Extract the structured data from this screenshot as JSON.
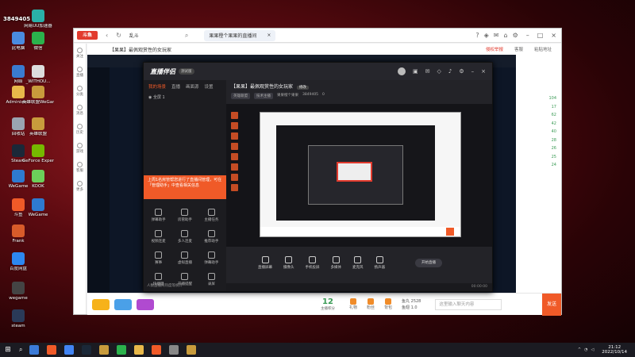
{
  "desktop": {
    "top_text": "3849405",
    "icons": [
      {
        "label": "此电脑",
        "color": "#4a8be0"
      },
      {
        "label": "网络",
        "color": "#3a7bd0"
      },
      {
        "label": "Administr...",
        "color": "#e8b84a"
      },
      {
        "label": "回收站",
        "color": "#9aa4b0"
      },
      {
        "label": "Steam",
        "color": "#1b2838"
      },
      {
        "label": "WeGame",
        "color": "#2e7ad0"
      },
      {
        "label": "斗鱼",
        "color": "#f05a28"
      },
      {
        "label": "Frank",
        "color": "#d85b2a"
      },
      {
        "label": "百度网盘",
        "color": "#2d87f0"
      },
      {
        "label": "wegame",
        "color": "#444444"
      },
      {
        "label": "steam",
        "color": "#2a3a58"
      },
      {
        "label": "网易UU加速器",
        "color": "#2ab0a8"
      },
      {
        "label": "微信",
        "color": "#2bb24c"
      },
      {
        "label": "_WITHOU...",
        "color": "#dddddd"
      },
      {
        "label": "英雄联盟WeGame版",
        "color": "#c89b3c"
      },
      {
        "label": "英雄联盟",
        "color": "#c89b3c"
      },
      {
        "label": "GeForce Experience",
        "color": "#76b900"
      },
      {
        "label": "KOOK",
        "color": "#6cd05a"
      },
      {
        "label": "WeGame",
        "color": "#2e7ad0"
      }
    ]
  },
  "browser": {
    "logo": "斗鱼",
    "search": "乱斗",
    "tab_label": "果果橙个果果的直播间",
    "header_title": "【果果】最佩观赏性的女玩家",
    "header_buttons": [
      "侵权举报",
      "客服",
      "粘贴地址"
    ],
    "left_items": [
      "关注",
      "直播",
      "分类",
      "消息",
      "历史",
      "游戏",
      "客服",
      "更多"
    ],
    "right_numbers": [
      "104",
      "17",
      "62",
      "42",
      "40",
      "28",
      "26",
      "25",
      "24"
    ],
    "bottom": {
      "fan_count": "12",
      "fan_label": "主播积分",
      "gifts": [
        "礼物",
        "粉丝",
        "背包"
      ],
      "yu_wan": "鱼丸 2528",
      "yu_chi": "鱼翅 1.0",
      "chat_placeholder": "这里输入聊天内容",
      "send": "发送"
    }
  },
  "app": {
    "logo": "直播伴侣",
    "version": "测试版",
    "tabs": [
      "我的场景",
      "直播",
      "画面源",
      "设置"
    ],
    "scene": "全屏 1",
    "tip": "上周1名房管帮您进行了直播间管理，可在「管理助手」中查看相关信息",
    "tools": [
      "弹幕助手",
      "房管助手",
      "主播任务",
      "视频连麦",
      "多人连麦",
      "推荐助手",
      "赛事",
      "虚拟直播",
      "弹幕助手",
      "快捷键",
      "开播提醒",
      "录屏"
    ],
    "footer": "人数直播间热度等统计",
    "room_title": "【果果】最佩观赏性的女玩家",
    "room_edit": "修改",
    "meta_tags": [
      "英雄联盟",
      "技术主播"
    ],
    "meta_room": "果果橙个果果",
    "meta_id": "3849405",
    "meta_fans": "0",
    "controls": [
      "直播屏幕",
      "摄像头",
      "手机投屏",
      "多媒体",
      "麦克风",
      "扬声器"
    ],
    "start_btn": "开始直播",
    "status": "00:00:00"
  },
  "taskbar": {
    "time": "21:12",
    "date": "2022/10/14",
    "icons": [
      "#3b7bd8",
      "#f05a28",
      "#4285f4",
      "#1b2838",
      "#c89b3c",
      "#2bb24c",
      "#e8b84a",
      "#f05a28",
      "#888888",
      "#c89b3c"
    ]
  }
}
